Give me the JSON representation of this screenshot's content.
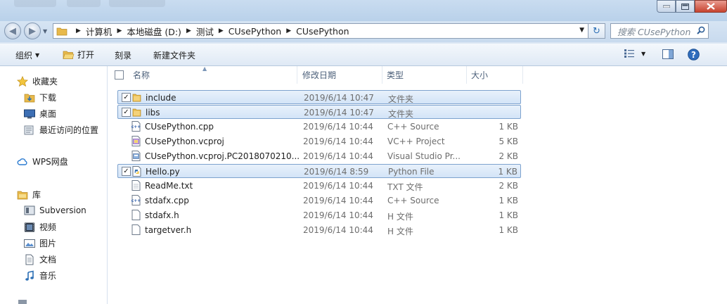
{
  "address": {
    "crumbs": [
      "计算机",
      "本地磁盘 (D:)",
      "测试",
      "CUsePython",
      "CUsePython"
    ]
  },
  "search": {
    "placeholder": "搜索 CUsePython"
  },
  "toolbar": {
    "organize": "组织",
    "open": "打开",
    "burn": "刻录",
    "new_folder": "新建文件夹"
  },
  "nav": {
    "favorites": "收藏夹",
    "downloads": "下载",
    "desktop": "桌面",
    "recent": "最近访问的位置",
    "wps": "WPS网盘",
    "libraries": "库",
    "subversion": "Subversion",
    "videos": "视频",
    "pictures": "图片",
    "documents": "文档",
    "music": "音乐"
  },
  "columns": {
    "name": "名称",
    "modified": "修改日期",
    "type": "类型",
    "size": "大小"
  },
  "files": [
    {
      "name": "include",
      "modified": "2019/6/14 10:47",
      "type": "文件夹",
      "size": "",
      "icon": "folder-icon",
      "selected": true
    },
    {
      "name": "libs",
      "modified": "2019/6/14 10:47",
      "type": "文件夹",
      "size": "",
      "icon": "folder-icon",
      "selected": true
    },
    {
      "name": "CUsePython.cpp",
      "modified": "2019/6/14 10:44",
      "type": "C++ Source",
      "size": "1 KB",
      "icon": "cpp-file-icon",
      "selected": false
    },
    {
      "name": "CUsePython.vcproj",
      "modified": "2019/6/14 10:44",
      "type": "VC++ Project",
      "size": "5 KB",
      "icon": "vcproj-file-icon",
      "selected": false
    },
    {
      "name": "CUsePython.vcproj.PC2018070210...",
      "modified": "2019/6/14 10:44",
      "type": "Visual Studio Pr...",
      "size": "2 KB",
      "icon": "vs-user-file-icon",
      "selected": false
    },
    {
      "name": "Hello.py",
      "modified": "2019/6/14 8:59",
      "type": "Python File",
      "size": "1 KB",
      "icon": "python-file-icon",
      "selected": true
    },
    {
      "name": "ReadMe.txt",
      "modified": "2019/6/14 10:44",
      "type": "TXT 文件",
      "size": "2 KB",
      "icon": "text-file-icon",
      "selected": false
    },
    {
      "name": "stdafx.cpp",
      "modified": "2019/6/14 10:44",
      "type": "C++ Source",
      "size": "1 KB",
      "icon": "cpp-file-icon",
      "selected": false
    },
    {
      "name": "stdafx.h",
      "modified": "2019/6/14 10:44",
      "type": "H 文件",
      "size": "1 KB",
      "icon": "header-file-icon",
      "selected": false
    },
    {
      "name": "targetver.h",
      "modified": "2019/6/14 10:44",
      "type": "H 文件",
      "size": "1 KB",
      "icon": "header-file-icon",
      "selected": false
    }
  ],
  "colors": {
    "selection_border": "#7da2ce",
    "selection_fill": "#d9e8f9",
    "folder": "#e8b94a"
  }
}
